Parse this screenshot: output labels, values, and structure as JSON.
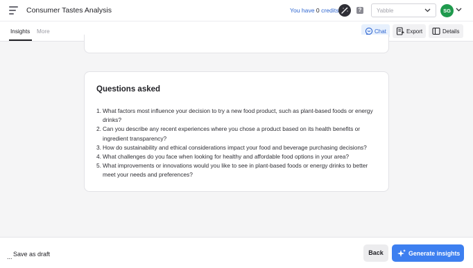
{
  "header": {
    "title": "Consumer Tastes Analysis",
    "credits_prefix": "You have ",
    "credits_count": "0",
    "credits_suffix": " credits",
    "select_value": "Yabble",
    "avatar_initials": "SG"
  },
  "tabs": [
    {
      "label": "Insights",
      "active": true
    },
    {
      "label": "More",
      "active": false
    }
  ],
  "toolbar": {
    "chat_label": "Chat",
    "export_label": "Export",
    "details_label": "Details"
  },
  "card": {
    "title": "Questions asked",
    "questions": [
      {
        "num": "1.",
        "text": "What factors most influence your decision to try a new food product, such as plant-based foods or energy drinks?"
      },
      {
        "num": "2.",
        "text": "Can you describe any recent experiences where you chose a product based on its health benefits or ingredient transparency?"
      },
      {
        "num": "3.",
        "text": "How do sustainability and ethical considerations impact your food and beverage purchasing decisions?"
      },
      {
        "num": "4.",
        "text": "What challenges do you face when looking for healthy and affordable food options in your area?"
      },
      {
        "num": "5.",
        "text": "What improvements or innovations would you like to see in plant-based foods or energy drinks to better meet your needs and preferences?"
      }
    ]
  },
  "footer": {
    "save_draft_label": "Save as draft",
    "more_label": "...",
    "back_label": "Back",
    "generate_label": "Generate insights"
  },
  "colors": {
    "accent": "#3d7ff0",
    "link": "#2f66d0",
    "avatar": "#1f9a4d"
  },
  "icons": [
    "menu-icon",
    "magic-wand-icon",
    "help-icon",
    "chevron-down-icon",
    "chat-icon",
    "export-icon",
    "panel-icon",
    "sparkle-icon"
  ]
}
